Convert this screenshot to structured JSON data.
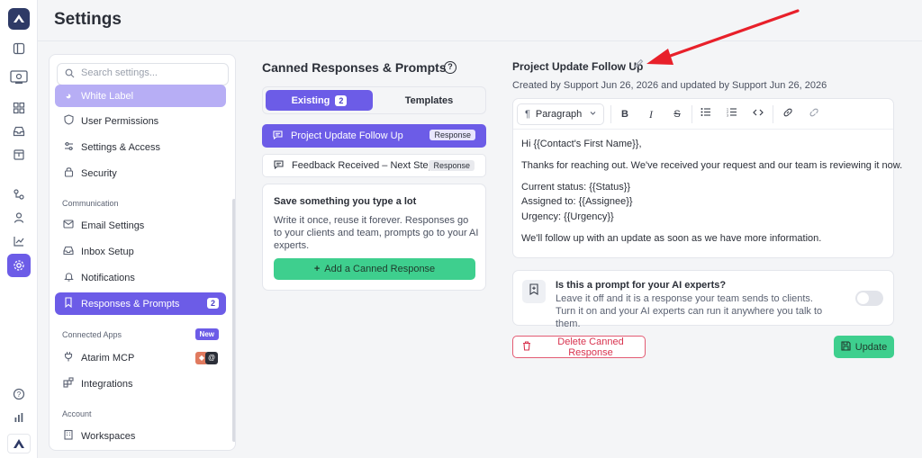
{
  "header": {
    "title": "Settings"
  },
  "rail": {
    "icons": [
      "app-logo",
      "sidebar-toggle-icon",
      "projects-icon",
      "dashboard-icon",
      "inbox-icon",
      "calendar-icon",
      "integrations-icon",
      "users-icon",
      "reports-icon",
      "settings-icon",
      "help-icon",
      "analytics-icon",
      "brand-icon"
    ]
  },
  "sidebar": {
    "search_placeholder": "Search settings...",
    "items": [
      {
        "label": "White Label",
        "icon": "palette-icon"
      },
      {
        "label": "User Permissions",
        "icon": "shield-icon"
      },
      {
        "label": "Settings & Access",
        "icon": "sliders-icon"
      },
      {
        "label": "Security",
        "icon": "lock-icon"
      }
    ],
    "communication_label": "Communication",
    "communication_items": [
      {
        "label": "Email Settings",
        "icon": "mail-icon"
      },
      {
        "label": "Inbox Setup",
        "icon": "inbox-icon"
      },
      {
        "label": "Notifications",
        "icon": "bell-icon"
      },
      {
        "label": "Responses & Prompts",
        "icon": "bookmark-icon",
        "count": "2"
      }
    ],
    "connected_label": "Connected Apps",
    "new_badge": "New",
    "connected_items": [
      {
        "label": "Atarim MCP",
        "icon": "plug-icon"
      },
      {
        "label": "Integrations",
        "icon": "puzzle-icon"
      }
    ],
    "account_label": "Account",
    "account_items": [
      {
        "label": "Workspaces",
        "icon": "building-icon"
      }
    ]
  },
  "canned": {
    "title": "Canned Responses & Prompts",
    "tabs": [
      {
        "label": "Existing",
        "count": "2"
      },
      {
        "label": "Templates"
      }
    ],
    "responses": [
      {
        "label": "Project Update Follow Up",
        "tag": "Response"
      },
      {
        "label": "Feedback Received – Next Steps",
        "tag": "Response"
      }
    ],
    "save_card": {
      "title": "Save something you type a lot",
      "description": "Write it once, reuse it forever. Responses go to your clients and team, prompts go to your AI experts.",
      "button": "Add a Canned Response"
    }
  },
  "detail": {
    "title": "Project Update Follow Up",
    "meta": "Created by Support Jun 26, 2026 and updated by Support Jun 26, 2026",
    "editor": {
      "format": "Paragraph",
      "lines": [
        "Hi {{Contact's First Name}},",
        "Thanks for reaching out. We've received your request and our team is reviewing it now.",
        "Current status: {{Status}}",
        "Assigned to: {{Assignee}}",
        "Urgency: {{Urgency}}",
        "We'll follow up with an update as soon as we have more information."
      ]
    },
    "prompt_toggle": {
      "title": "Is this a prompt for your AI experts?",
      "description": "Leave it off and it is a response your team sends to clients. Turn it on and your AI experts can run it anywhere you talk to them."
    },
    "delete_button": "Delete Canned Response",
    "update_button": "Update"
  },
  "colors": {
    "accent": "#6c5ce7",
    "success": "#3ecf8e",
    "danger": "#d8334f",
    "annotation_arrow": "#e8202a"
  }
}
